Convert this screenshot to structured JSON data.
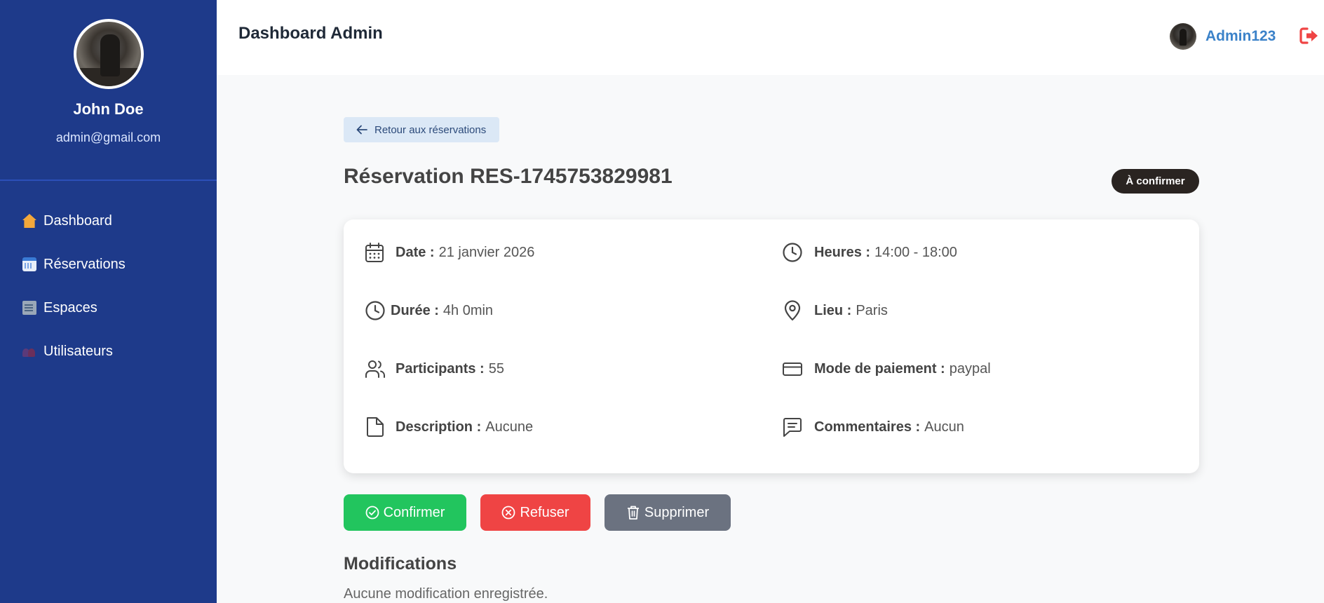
{
  "sidebar": {
    "profile": {
      "name": "John Doe",
      "email": "admin@gmail.com"
    },
    "items": [
      {
        "label": "Dashboard",
        "icon": "house-emoji"
      },
      {
        "label": "Réservations",
        "icon": "calendar-emoji"
      },
      {
        "label": "Espaces",
        "icon": "building-emoji"
      },
      {
        "label": "Utilisateurs",
        "icon": "users-emoji"
      }
    ]
  },
  "header": {
    "title": "Dashboard Admin",
    "username": "Admin123",
    "logout_icon": "logout-icon"
  },
  "main": {
    "back_label": "Retour aux réservations",
    "title": "Réservation RES-1745753829981",
    "status": "À confirmer",
    "details": {
      "date": {
        "label": "Date :",
        "value": "21 janvier 2026"
      },
      "hours": {
        "label": "Heures :",
        "value": "14:00 - 18:00"
      },
      "duration": {
        "label": "Durée :",
        "value": "4h 0min"
      },
      "place": {
        "label": "Lieu :",
        "value": "Paris"
      },
      "participants": {
        "label": "Participants :",
        "value": "55"
      },
      "payment": {
        "label": "Mode de paiement :",
        "value": "paypal"
      },
      "description": {
        "label": "Description :",
        "value": "Aucune"
      },
      "comments": {
        "label": "Commentaires :",
        "value": "Aucun"
      }
    },
    "actions": {
      "confirm": "Confirmer",
      "refuse": "Refuser",
      "delete": "Supprimer"
    },
    "modifications": {
      "title": "Modifications",
      "empty": "Aucune modification enregistrée."
    }
  },
  "colors": {
    "sidebar_bg": "#1e3a8a",
    "confirm": "#22c55e",
    "refuse": "#ef4444",
    "delete": "#6b7280",
    "badge": "#2a2421",
    "accent": "#3b82c9"
  }
}
